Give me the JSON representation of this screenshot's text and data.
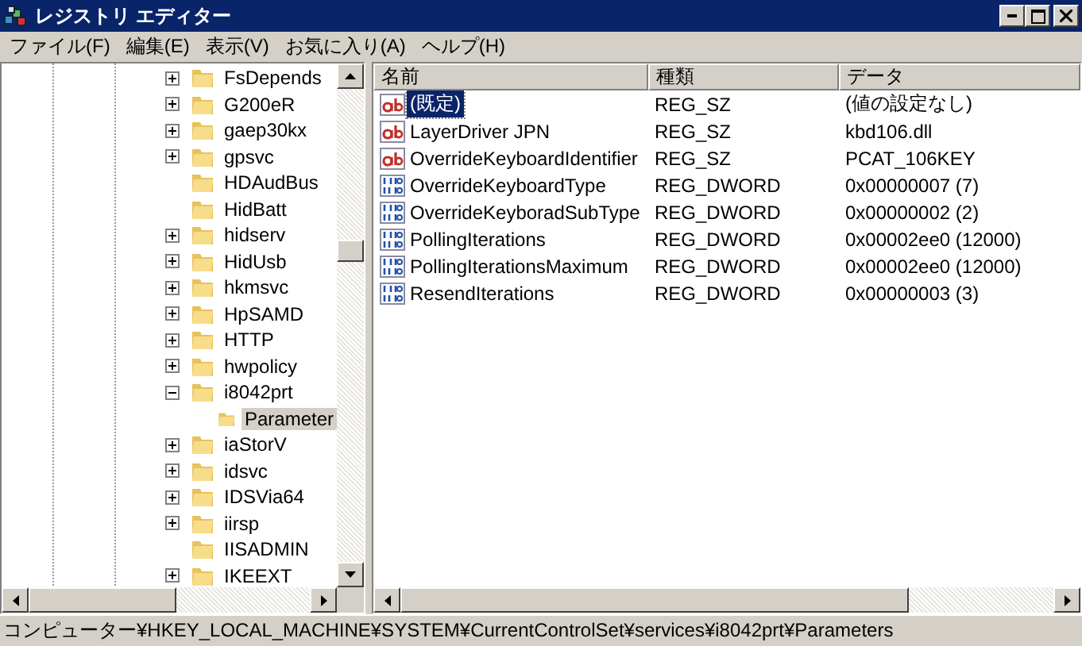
{
  "window": {
    "title": "レジストリ エディター"
  },
  "menu": [
    "ファイル(F)",
    "編集(E)",
    "表示(V)",
    "お気に入り(A)",
    "ヘルプ(H)"
  ],
  "tree": {
    "items": [
      {
        "label": "FsDepends",
        "has_children": true,
        "expanded": false,
        "selected": false
      },
      {
        "label": "G200eR",
        "has_children": true,
        "expanded": false,
        "selected": false
      },
      {
        "label": "gaep30kx",
        "has_children": true,
        "expanded": false,
        "selected": false
      },
      {
        "label": "gpsvc",
        "has_children": true,
        "expanded": false,
        "selected": false
      },
      {
        "label": "HDAudBus",
        "has_children": false,
        "selected": false
      },
      {
        "label": "HidBatt",
        "has_children": false,
        "selected": false
      },
      {
        "label": "hidserv",
        "has_children": true,
        "expanded": false,
        "selected": false
      },
      {
        "label": "HidUsb",
        "has_children": true,
        "expanded": false,
        "selected": false
      },
      {
        "label": "hkmsvc",
        "has_children": true,
        "expanded": false,
        "selected": false
      },
      {
        "label": "HpSAMD",
        "has_children": true,
        "expanded": false,
        "selected": false
      },
      {
        "label": "HTTP",
        "has_children": true,
        "expanded": false,
        "selected": false
      },
      {
        "label": "hwpolicy",
        "has_children": true,
        "expanded": false,
        "selected": false
      },
      {
        "label": "i8042prt",
        "has_children": true,
        "expanded": true,
        "selected": false,
        "children": [
          {
            "label": "Parameter",
            "has_children": false,
            "selected": true
          }
        ]
      },
      {
        "label": "iaStorV",
        "has_children": true,
        "expanded": false,
        "selected": false
      },
      {
        "label": "idsvc",
        "has_children": true,
        "expanded": false,
        "selected": false
      },
      {
        "label": "IDSVia64",
        "has_children": true,
        "expanded": false,
        "selected": false
      },
      {
        "label": "iirsp",
        "has_children": true,
        "expanded": false,
        "selected": false
      },
      {
        "label": "IISADMIN",
        "has_children": false,
        "selected": false
      },
      {
        "label": "IKEEXT",
        "has_children": true,
        "expanded": false,
        "selected": false
      }
    ]
  },
  "values": {
    "columns": [
      "名前",
      "種類",
      "データ"
    ],
    "rows": [
      {
        "kind": "sz",
        "name": "(既定)",
        "type": "REG_SZ",
        "data": "(値の設定なし)",
        "selected": true
      },
      {
        "kind": "sz",
        "name": "LayerDriver JPN",
        "type": "REG_SZ",
        "data": "kbd106.dll",
        "selected": false
      },
      {
        "kind": "sz",
        "name": "OverrideKeyboardIdentifier",
        "type": "REG_SZ",
        "data": "PCAT_106KEY",
        "selected": false
      },
      {
        "kind": "dword",
        "name": "OverrideKeyboardType",
        "type": "REG_DWORD",
        "data": "0x00000007 (7)",
        "selected": false
      },
      {
        "kind": "dword",
        "name": "OverrideKeyboradSubType",
        "type": "REG_DWORD",
        "data": "0x00000002 (2)",
        "selected": false
      },
      {
        "kind": "dword",
        "name": "PollingIterations",
        "type": "REG_DWORD",
        "data": "0x00002ee0 (12000)",
        "selected": false
      },
      {
        "kind": "dword",
        "name": "PollingIterationsMaximum",
        "type": "REG_DWORD",
        "data": "0x00002ee0 (12000)",
        "selected": false
      },
      {
        "kind": "dword",
        "name": "ResendIterations",
        "type": "REG_DWORD",
        "data": "0x00000003 (3)",
        "selected": false
      }
    ]
  },
  "status_bar": "コンピューター¥HKEY_LOCAL_MACHINE¥SYSTEM¥CurrentControlSet¥services¥i8042prt¥Parameters"
}
